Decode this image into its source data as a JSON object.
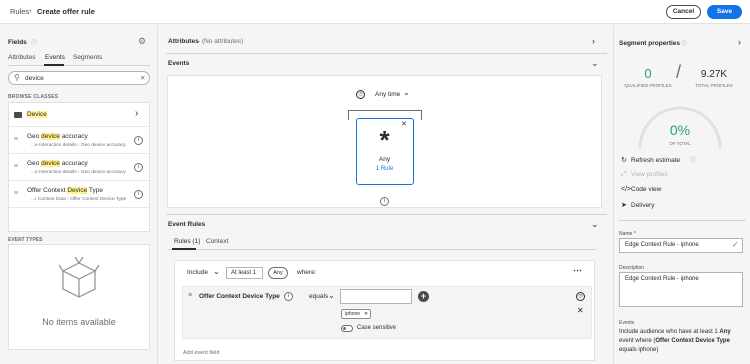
{
  "header": {
    "breadcrumb_root": "Rules",
    "breadcrumb_sep": "›",
    "title": "Create offer rule",
    "cancel_label": "Cancel",
    "save_label": "Save",
    "accent": "#1473e6"
  },
  "fields_panel": {
    "title": "Fields",
    "tabs": [
      "Attributes",
      "Events",
      "Segments"
    ],
    "active_tab": "Events",
    "search_value": "device",
    "search_placeholder": "Search",
    "browse_label": "BROWSE CLASSES",
    "items": [
      {
        "pre": "",
        "hl": "Device",
        "post": "",
        "path": "",
        "type": "folder"
      },
      {
        "pre": "Geo ",
        "hl": "device",
        "post": " accuracy",
        "path": "...e Interaction details › Geo device accuracy",
        "type": "field"
      },
      {
        "pre": "Geo ",
        "hl": "device",
        "post": " accuracy",
        "path": "...e Interaction details › Geo device accuracy",
        "type": "field"
      },
      {
        "pre": "Offer Context ",
        "hl": "Device",
        "post": " Type",
        "path": "...r Context Data › Offer Context Device Type",
        "type": "field"
      }
    ],
    "event_types_label": "EVENT TYPES",
    "empty_label": "No items available"
  },
  "center": {
    "attributes_title": "Attributes",
    "attributes_sub": "- (No attributes)",
    "events_title": "Events",
    "time_filter": "Any time",
    "event_card": {
      "title": "Any",
      "rules": "1 Rule",
      "symbol": "*"
    },
    "event_rules_title": "Event Rules",
    "rule_tabs": [
      "Rules (1)",
      "Context"
    ],
    "include": "Include",
    "at_least": "At least 1",
    "any_pill": "Any",
    "where": "where:",
    "condition": {
      "field": "Offer Context Device Type",
      "operator": "equals",
      "value_input": "",
      "tag": "iphone",
      "case_sensitive_label": "Case sensitive",
      "case_sensitive": false
    },
    "add_event_field": "Add event field"
  },
  "segment_properties": {
    "title": "Segment properties",
    "qualified_count": "0",
    "qualified_label": "QUALIFIED PROFILES",
    "total_count": "9.27K",
    "total_label": "TOTAL PROFILES",
    "percent": "0%",
    "percent_fraction": 0,
    "percent_label": "OF TOTAL",
    "success_color": "#2d9d78",
    "actions": [
      {
        "label": "Refresh estimate",
        "icon": "refresh-icon",
        "enabled": true
      },
      {
        "label": "View profiles",
        "icon": "view-profiles-icon",
        "enabled": false
      },
      {
        "label": "Code view",
        "icon": "code-icon",
        "enabled": true
      },
      {
        "label": "Delivery",
        "icon": "delivery-icon",
        "enabled": true
      }
    ],
    "name_label": "Name *",
    "name_value": "Edge Context Rule - iphone",
    "description_label": "Description",
    "description_value": "Edge Context Rule - iphone",
    "events_label": "Events",
    "events_summary": {
      "t1": "Include audience who have at least 1 ",
      "b1": "Any",
      "t2": " event where (",
      "b2": "Offer Context Device Type",
      "t3": " equals iphone)"
    }
  }
}
